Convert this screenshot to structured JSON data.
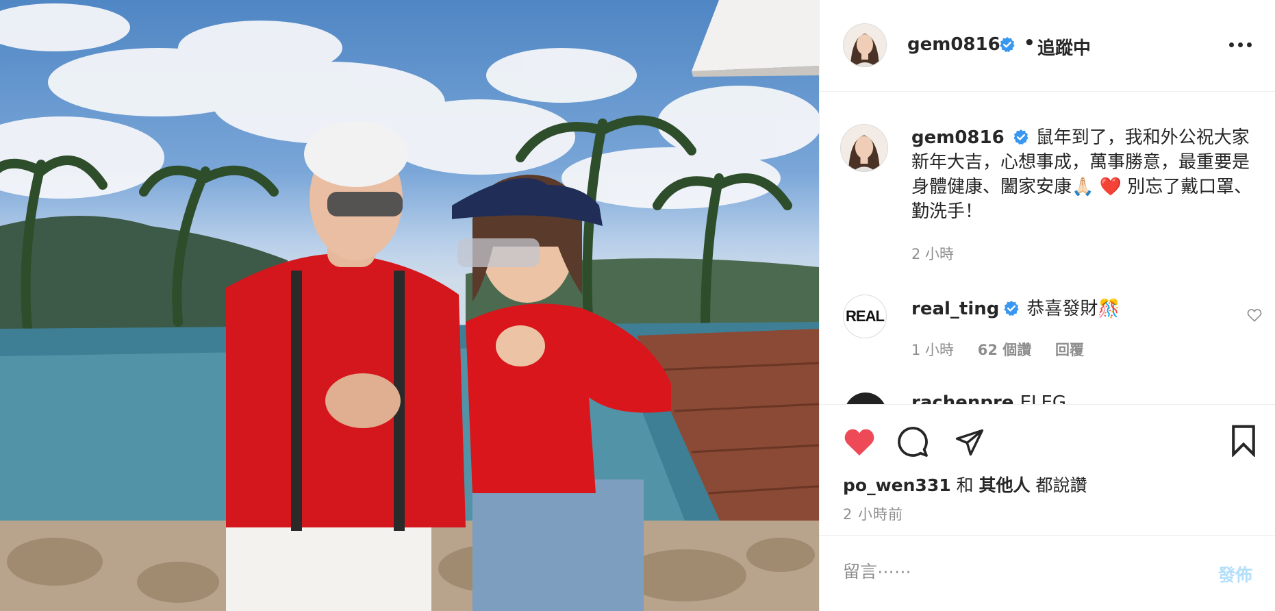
{
  "post": {
    "author": "gem0816",
    "follow_status": "追蹤中",
    "separator": "•",
    "caption": "鼠年到了，我和外公祝大家新年大吉，心想事成，萬事勝意，最重要是身體健康、闔家安康🙏🏻 ❤️ 別忘了戴口罩、勤洗手！",
    "caption_time": "2 小時"
  },
  "comments": [
    {
      "username": "real_ting",
      "avatar_text": "REAL",
      "text": "恭喜發財🎊",
      "time": "1 小時",
      "likes": "62 個讚",
      "reply_label": "回覆"
    },
    {
      "username": "rachenpre",
      "text": "ELEG"
    }
  ],
  "actions": {
    "liked_by": "po_wen331",
    "and_label": "和",
    "others_label": "其他人",
    "said_label": "都說讚",
    "posted": "2 小時前"
  },
  "composer": {
    "placeholder": "留言⋯⋯",
    "post_label": "發佈"
  },
  "colors": {
    "heart": "#ed4956",
    "verified": "#3897f0",
    "post_button_disabled": "#b2dffc",
    "muted_text": "#8e8e8e"
  },
  "icons": [
    "verified-badge-icon",
    "more-options-icon",
    "heart-icon",
    "comment-icon",
    "share-icon",
    "bookmark-icon",
    "like-comment-icon"
  ]
}
